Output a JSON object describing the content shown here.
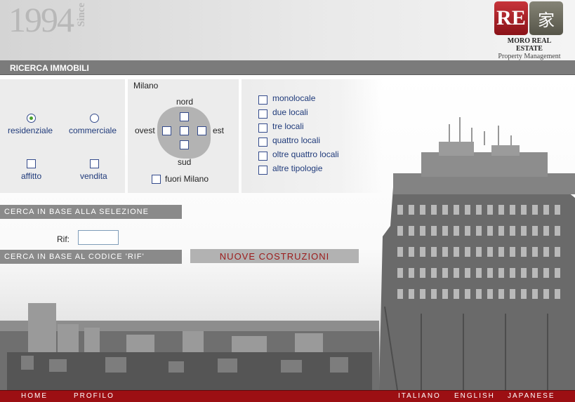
{
  "header": {
    "since_year": "1994",
    "since_word": "Since",
    "logo_re": "RE",
    "logo_kanji": "家",
    "brand": "MORO REAL ESTATE",
    "brand_sub": "Property Management"
  },
  "section_title": "RICERCA IMMOBILI",
  "type": {
    "residential": "residenziale",
    "commercial": "commerciale",
    "rent": "affitto",
    "sale": "vendita",
    "selected": "residenziale"
  },
  "zone": {
    "city": "Milano",
    "north": "nord",
    "south": "sud",
    "west": "ovest",
    "east": "est",
    "outside": "fuori Milano"
  },
  "rooms": [
    "monolocale",
    "due locali",
    "tre locali",
    "quattro locali",
    "oltre quattro locali",
    "altre tipologie"
  ],
  "buttons": {
    "search_selection": "Cerca in base alla selezione",
    "search_code": "Cerca in base al codice 'Rif'",
    "new_constructions": "Nuove Costruzioni"
  },
  "rif_label": "Rif:",
  "rif_value": "",
  "footer": {
    "home": "Home",
    "profile": "Profilo",
    "italian": "Italiano",
    "english": "English",
    "japanese": "Japanese"
  },
  "colors": {
    "footer": "#9c0f13",
    "logo_red": "#a9232a",
    "button_gray": "#8a8a8a"
  }
}
